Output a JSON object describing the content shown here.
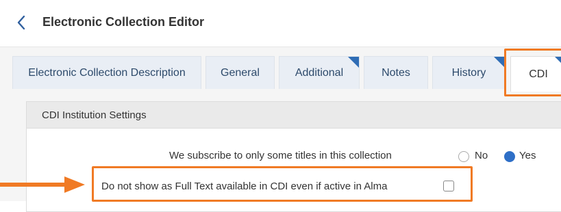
{
  "header": {
    "title": "Electronic Collection Editor"
  },
  "tabs": [
    {
      "label": "Electronic Collection Description"
    },
    {
      "label": "General"
    },
    {
      "label": "Additional"
    },
    {
      "label": "Notes"
    },
    {
      "label": "History"
    },
    {
      "label": "CDI"
    }
  ],
  "active_tab": "CDI",
  "panel": {
    "title": "CDI Institution Settings",
    "subscribe_label": "We subscribe to only some titles in this collection",
    "radio_no": "No",
    "radio_yes": "Yes",
    "radio_selected": "Yes",
    "fulltext_label": "Do not show as Full Text available in CDI even if active in Alma",
    "fulltext_checked": false
  },
  "colors": {
    "highlight": "#f07a24",
    "accent": "#2e6fc7",
    "tab_text": "#2d4a6b"
  }
}
